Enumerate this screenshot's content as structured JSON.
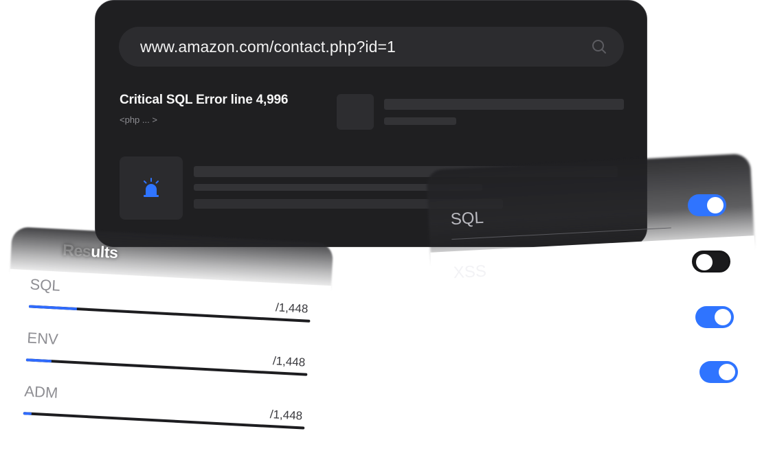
{
  "browser": {
    "url": "www.amazon.com/contact.php?id=1",
    "error_title": "Critical SQL Error line 4,996",
    "error_subtitle": "<php ... >"
  },
  "results": {
    "title_visible": "ults",
    "title_faded": "Res",
    "rows": [
      {
        "label": "SQL",
        "count": "/1,448",
        "fraction": 0.17
      },
      {
        "label": "ENV",
        "count": "/1,448",
        "fraction": 0.09
      },
      {
        "label": "ADM",
        "count": "/1,448",
        "fraction": 0.03
      }
    ]
  },
  "options": {
    "items": [
      {
        "label": "SQL",
        "enabled": true
      },
      {
        "label": "XSS",
        "enabled": false
      },
      {
        "label": "",
        "enabled": true
      },
      {
        "label": "",
        "enabled": true
      }
    ]
  },
  "colors": {
    "accent": "#2f74ff",
    "dark_panel": "#1f1f21"
  },
  "icons": {
    "search": "search-icon",
    "alert": "siren-icon"
  }
}
